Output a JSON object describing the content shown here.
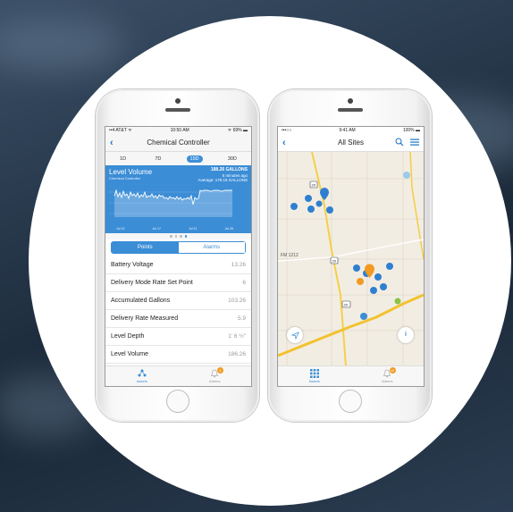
{
  "phone1": {
    "status": {
      "carrier": "••4 AT&T ᯤ",
      "time": "10:50 AM",
      "battery": "ᯤ 69% ▬"
    },
    "title": "Chemical Controller",
    "back_icon": "chevron-left-icon",
    "ranges": [
      "1D",
      "7D",
      "15D",
      "30D"
    ],
    "selected_range": "15D",
    "chart": {
      "title": "Level Volume",
      "subtitle": "Chemical Controller",
      "value": "188.26 GALLONS",
      "value_sub1": "5 minutes ago",
      "value_sub2": "Average: 178.15 GALLONS",
      "ticks": [
        "Jul 13",
        "Jul 17",
        "Jul 21",
        "Jul 25"
      ]
    },
    "segments": {
      "points": "Points",
      "alarms": "Alarms",
      "selected": "Points"
    },
    "rows": [
      {
        "label": "Battery Voltage",
        "value": "13.26"
      },
      {
        "label": "Delivery Mode Rate Set Point",
        "value": "6"
      },
      {
        "label": "Accumulated Gallons",
        "value": "103.26"
      },
      {
        "label": "Delivery Rate Measured",
        "value": "5.9"
      },
      {
        "label": "Level Depth",
        "value": "1' 6 ½\""
      },
      {
        "label": "Level Volume",
        "value": "186.26"
      }
    ],
    "tabs": [
      {
        "label": "Assets",
        "icon": "assets-icon",
        "active": true
      },
      {
        "label": "Alarms",
        "icon": "bell-icon",
        "active": false,
        "badge": "4"
      }
    ]
  },
  "phone2": {
    "status": {
      "carrier": "•••○○",
      "time": "9:41 AM",
      "battery": "100% ▬"
    },
    "title": "All Sites",
    "icons": [
      "search-icon",
      "menu-icon"
    ],
    "map": {
      "road_label": "FM 1212",
      "route_shields": [
        "20",
        "20",
        "20"
      ],
      "blue": "#2f7fd1",
      "orange": "#f29a22",
      "green": "#8bc34a"
    },
    "buttons": {
      "locate_icon": "location-arrow-icon",
      "info_icon": "info-icon",
      "info": "i"
    },
    "tabs": [
      {
        "label": "Assets",
        "icon": "grid-icon",
        "active": true
      },
      {
        "label": "Alarms",
        "icon": "bell-icon",
        "active": false,
        "badge": "12"
      }
    ]
  }
}
